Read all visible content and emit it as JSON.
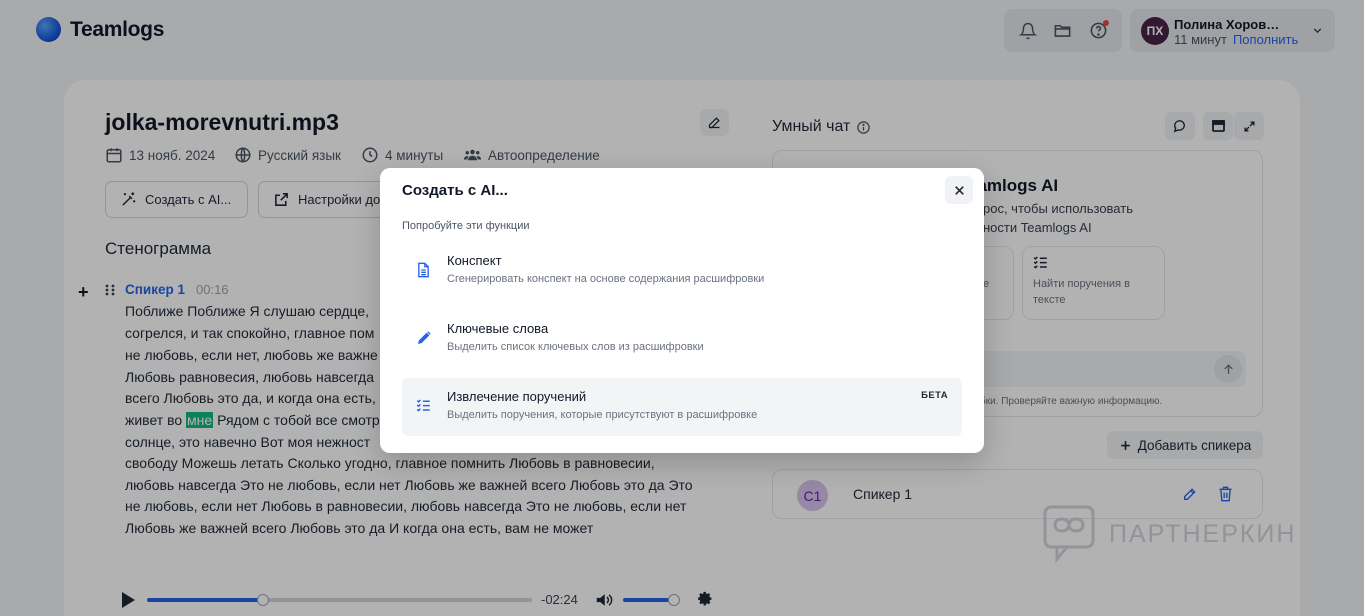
{
  "app": {
    "name": "Teamlogs"
  },
  "header": {
    "user_initials": "ПХ",
    "user_name": "Полина Хоров…",
    "minutes": "11 минут",
    "topup": "Пополнить"
  },
  "file": {
    "title": "jolka-morevnutri.mp3",
    "date": "13 нояб. 2024",
    "language": "Русский язык",
    "duration": "4 минуты",
    "speakers_mode": "Автоопределение"
  },
  "actions": {
    "create_ai": "Создать с AI...",
    "settings": "Настройки до"
  },
  "transcript": {
    "section_title": "Стенограмма",
    "speaker": "Спикер 1",
    "timestamp": "00:16",
    "lines": [
      "Поближе Поближе Я слушаю сердце,",
      "согрелся, и так спокойно, главное пом",
      "не любовь, если нет, любовь же важне",
      "Любовь равновесия, любовь навсегда",
      "всего Любовь это да, и когда она есть,",
      "живет во",
      "солнце, это навечно Вот моя нежност",
      "свободу Можешь летать Сколько угодно, главное помнить Любовь в равновесии,",
      "любовь навсегда Это не любовь, если нет Любовь же важней всего Любовь это да Это",
      "не любовь, если нет Любовь в равновесии, любовь навсегда Это не любовь, если нет",
      "Любовь же важней всего Любовь это да И когда она есть, вам не может"
    ],
    "highlight_word": "мне",
    "after_highlight": " Рядом с тобой все смотр"
  },
  "player": {
    "remaining": "-02:24",
    "progress": 0.3,
    "volume": 0.9
  },
  "chat": {
    "title": "Умный чат",
    "bot_name": "eamlogs AI",
    "sub1": "рос, чтобы использовать",
    "sub2": "ности Teamlogs AI",
    "tile1": "е",
    "tile2_line1": "Найти поручения в",
    "tile2_line2": "тексте",
    "disclaimer": "бки. Проверяйте важную информацию."
  },
  "speakers": {
    "add_label": "Добавить спикера",
    "initials": "С1",
    "name": "Спикер 1"
  },
  "watermark": "ПАРТНЕРКИН",
  "modal": {
    "title": "Создать с AI...",
    "subtitle": "Попробуйте эти функции",
    "options": [
      {
        "title": "Конспект",
        "desc": "Сгенерировать конспект на основе содержания расшифровки",
        "icon": "document-icon"
      },
      {
        "title": "Ключевые слова",
        "desc": "Выделить список ключевых слов из расшифровки",
        "icon": "pencil-icon"
      },
      {
        "title": "Извлечение поручений",
        "desc": "Выделить поручения, которые присутствуют в расшифровке",
        "icon": "task-list-icon",
        "badge": "БЕТА"
      }
    ]
  },
  "colors": {
    "accent": "#2563eb",
    "highlight": "#10b981",
    "avatar": "#4a2347"
  }
}
